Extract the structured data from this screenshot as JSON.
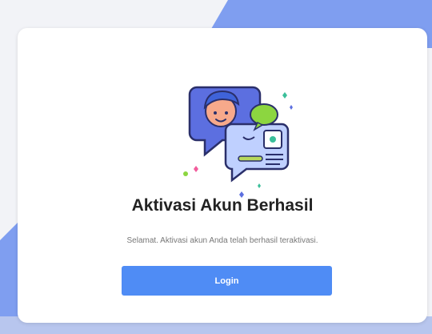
{
  "card": {
    "title": "Aktivasi Akun Berhasil",
    "message": "Selamat. Aktivasi akun Anda telah berhasil teraktivasi.",
    "login_button_label": "Login"
  },
  "illustration": {
    "icon": "user-chat-profile-illustration"
  },
  "colors": {
    "accent": "#4f8cf5",
    "background_shape": "#7f9ef0",
    "card_background": "#ffffff",
    "title_text": "#222222",
    "message_text": "#777777"
  }
}
